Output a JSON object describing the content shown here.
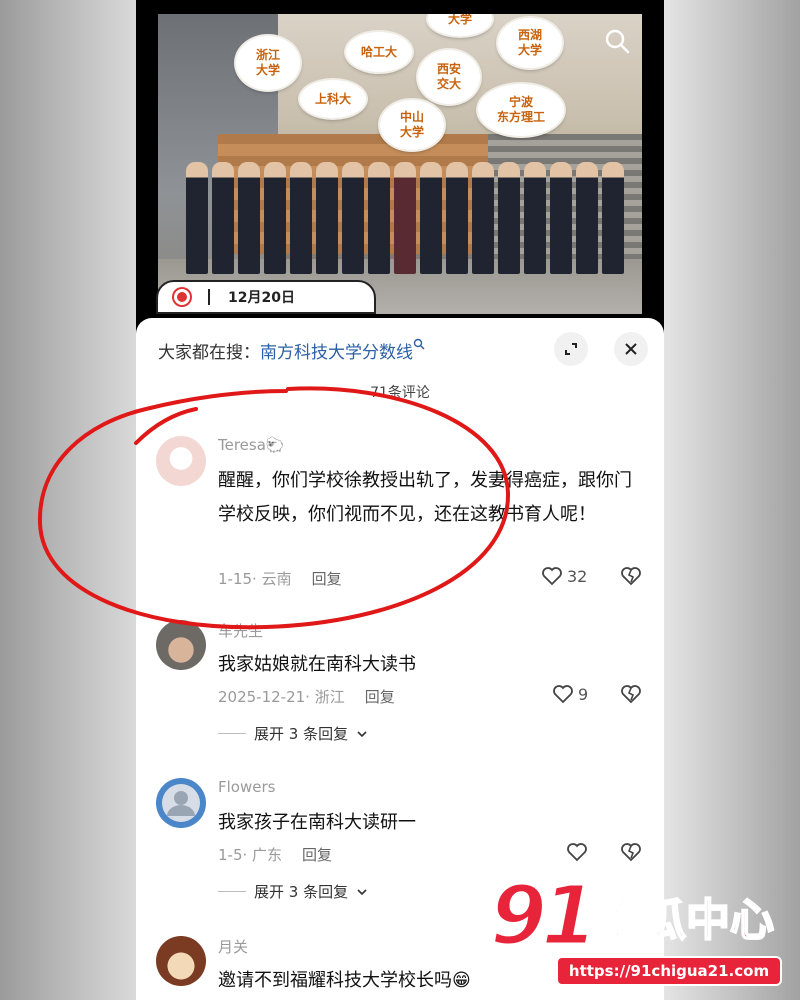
{
  "photo": {
    "bubbles": [
      "浙江\n大学",
      "哈工大",
      "大学",
      "西湖\n大学",
      "上科大",
      "西安\n交大",
      "中山\n大学",
      "宁波\n东方理工"
    ],
    "date_label": "12月20日"
  },
  "sheet": {
    "search_prefix": "大家都在搜：",
    "search_link": "南方科技大学分数线",
    "comment_count": "71条评论"
  },
  "comments": [
    {
      "user": "Teresa🐑",
      "text": "醒醒，你们学校徐教授出轨了，发妻得癌症，跟你门学校反映，你们视而不见，还在这教书育人呢！",
      "meta": "1-15· 云南",
      "reply": "回复",
      "likes": "32"
    },
    {
      "user": "车先生",
      "text": "我家姑娘就在南科大读书",
      "meta": "2025-12-21· 浙江",
      "reply": "回复",
      "likes": "9",
      "expand": "展开 3 条回复"
    },
    {
      "user": "Flowers",
      "text": "我家孩子在南科大读研一",
      "meta": "1-5· 广东",
      "reply": "回复",
      "likes": "",
      "expand": "展开 3 条回复"
    },
    {
      "user": "月关",
      "text": "邀请不到福耀科技大学校长吗😁",
      "meta": "",
      "reply": "",
      "likes": ""
    }
  ],
  "watermark": {
    "number": "91",
    "name": "吃瓜中心",
    "url": "https://91chigua21.com"
  },
  "colors": {
    "link": "#2b5fa8",
    "watermark_red": "#e8243a",
    "circle_red": "#e01818"
  }
}
